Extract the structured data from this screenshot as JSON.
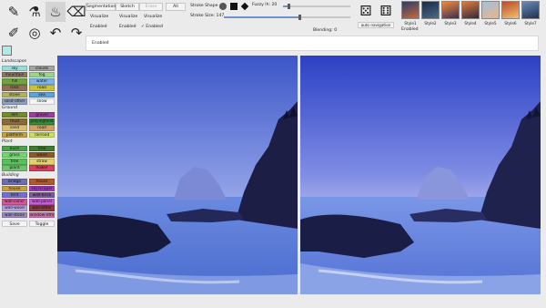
{
  "tools": [
    {
      "name": "pen-tool-icon",
      "glyph": "✎",
      "active": false
    },
    {
      "name": "pipette-tool-icon",
      "glyph": "⚗",
      "active": false
    },
    {
      "name": "fill-bucket-tool-icon",
      "glyph": "♨",
      "active": true
    },
    {
      "name": "eraser-tool-icon",
      "glyph": "⌫",
      "active": false
    },
    {
      "name": "brush-tool-icon",
      "glyph": "✐",
      "active": false
    },
    {
      "name": "swirl-tool-icon",
      "glyph": "◎",
      "active": false
    },
    {
      "name": "undo-tool-icon",
      "glyph": "↶",
      "active": false
    },
    {
      "name": "redo-tool-icon",
      "glyph": "↷",
      "active": false
    }
  ],
  "top": {
    "segmentation_label": "Segmentation",
    "sketch_label": "Sketch",
    "erase_label": "Erase",
    "all_label": "All",
    "visualize_label_1": "Visualize",
    "visualize_label_2": "Visualize",
    "visualize_label_3": "Visualize",
    "enabled_label_1": "Enabled",
    "enabled_label_2": "Enabled",
    "enabled_label_3": "✓ Enabled",
    "stroke_shape_label": "Stroke Shape",
    "fuzzy_label": "Fuzzy lh: 20",
    "stroke_size_label": "Stroke Size: 147",
    "blending_label": "Blending: 0",
    "auto_nav_label": "auto navigation",
    "enabled_label_4": "Enabled",
    "enabled_bar_label": "Enabled"
  },
  "sliders": {
    "fuzzy": 0.08,
    "stroke_size": 0.6,
    "blending": 0.0
  },
  "styles": [
    {
      "label": "Style1",
      "color1": "#2c3c64",
      "color2": "#c46a3e"
    },
    {
      "label": "Style2",
      "color1": "#1b2a44",
      "color2": "#4b6a8a"
    },
    {
      "label": "Style3",
      "color1": "#f08a3c",
      "color2": "#3a3050"
    },
    {
      "label": "Style4",
      "color1": "#e07b3a",
      "color2": "#2f2a3e"
    },
    {
      "label": "Style5",
      "color1": "#a4c0da",
      "color2": "#e8b48a"
    },
    {
      "label": "Style6",
      "color1": "#b84c2a",
      "color2": "#f2c070"
    },
    {
      "label": "Style7",
      "color1": "#6a8ab4",
      "color2": "#1f3050"
    }
  ],
  "palette": {
    "sections": [
      {
        "title": "Landscapes",
        "items": [
          {
            "label": "sky",
            "color": "#9ad9d8"
          },
          {
            "label": "clouds",
            "color": "#a3a3a3"
          },
          {
            "label": "mountain",
            "color": "#8b7a6b"
          },
          {
            "label": "fog",
            "color": "#9bd48d"
          },
          {
            "label": "hill",
            "color": "#6ea33e"
          },
          {
            "label": "water",
            "color": "#7fb2e6"
          },
          {
            "label": "rock",
            "color": "#8e6f56"
          },
          {
            "label": "road",
            "color": "#c6c23c"
          },
          {
            "label": "stone",
            "color": "#b0b060"
          },
          {
            "label": "sea",
            "color": "#5ea0d8"
          },
          {
            "label": "solid-other",
            "color": "#8fa0c0"
          },
          {
            "label": "snow",
            "color": "#f4f4f4"
          }
        ]
      },
      {
        "title": "Ground",
        "items": [
          {
            "label": "dirt",
            "color": "#6f8d2a"
          },
          {
            "label": "gravel",
            "color": "#a03aa0"
          },
          {
            "label": "mud",
            "color": "#8a6a3a"
          },
          {
            "label": "playingfield",
            "color": "#3a8a3a"
          },
          {
            "label": "sand",
            "color": "#d8c070"
          },
          {
            "label": "road",
            "color": "#d0a060"
          },
          {
            "label": "platform",
            "color": "#c0a040"
          },
          {
            "label": "railroad",
            "color": "#c8e060"
          }
        ]
      },
      {
        "title": "Plant",
        "items": [
          {
            "label": "bush",
            "color": "#4fa04f"
          },
          {
            "label": "tree",
            "color": "#3f7a2f"
          },
          {
            "label": "grass",
            "color": "#6ed86e"
          },
          {
            "label": "wood",
            "color": "#8a5a2a"
          },
          {
            "label": "tree",
            "color": "#5ac05a"
          },
          {
            "label": "straw",
            "color": "#e0d070"
          },
          {
            "label": "plant",
            "color": "#70c070"
          },
          {
            "label": "flower",
            "color": "#d04060"
          }
        ]
      },
      {
        "title": "Building",
        "items": [
          {
            "label": "bridge",
            "color": "#6f6fb0"
          },
          {
            "label": "house",
            "color": "#b05a2a"
          },
          {
            "label": "house",
            "color": "#c8a040"
          },
          {
            "label": "skyscraper",
            "color": "#a040c0"
          },
          {
            "label": "tent",
            "color": "#7070d0"
          },
          {
            "label": "wall-brick",
            "color": "#7a5aa0"
          },
          {
            "label": "wall-concr",
            "color": "#d05a9a"
          },
          {
            "label": "wall-panel",
            "color": "#c060d0"
          },
          {
            "label": "wall-wood",
            "color": "#b0a0e0"
          },
          {
            "label": "wall-other",
            "color": "#8a3a3a"
          },
          {
            "label": "wall-stone",
            "color": "#9a8ac0"
          },
          {
            "label": "window-other",
            "color": "#d070b0"
          }
        ]
      }
    ],
    "save_label": "Save",
    "toggle_label": "Toggle",
    "selected_color": "#aeeae6"
  }
}
